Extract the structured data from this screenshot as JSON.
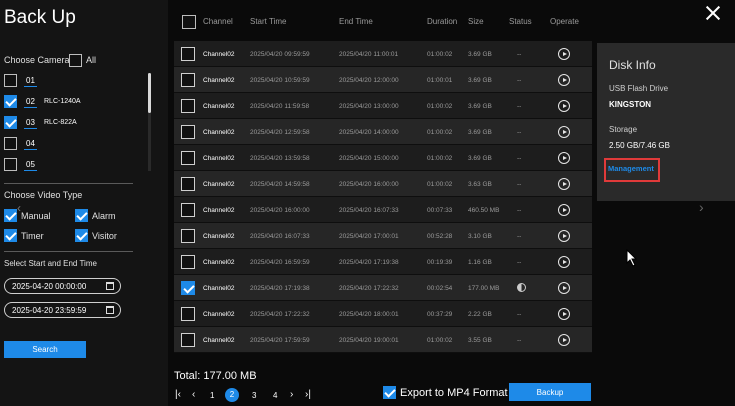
{
  "title": "Back Up",
  "camera": {
    "label": "Choose Camera",
    "all_label": "All",
    "items": [
      {
        "num": "01",
        "model": "",
        "checked": false
      },
      {
        "num": "02",
        "model": "RLC-1240A",
        "checked": true
      },
      {
        "num": "03",
        "model": "RLC-822A",
        "checked": true
      },
      {
        "num": "04",
        "model": "",
        "checked": false
      },
      {
        "num": "05",
        "model": "",
        "checked": false
      }
    ]
  },
  "video_type": {
    "label": "Choose Video Type",
    "items": [
      {
        "label": "Manual",
        "checked": true
      },
      {
        "label": "Alarm",
        "checked": true
      },
      {
        "label": "Timer",
        "checked": true
      },
      {
        "label": "Visitor",
        "checked": true
      }
    ]
  },
  "time_range": {
    "label": "Select Start and End Time",
    "start": "2025-04-20 00:00:00",
    "end": "2025-04-20 23:59:59"
  },
  "search_label": "Search",
  "table": {
    "headers": {
      "channel": "Channel",
      "start": "Start Time",
      "end": "End Time",
      "duration": "Duration",
      "size": "Size",
      "status": "Status",
      "operate": "Operate"
    },
    "rows": [
      {
        "channel": "Channel02",
        "start": "2025/04/20 09:59:59",
        "end": "2025/04/20 11:00:01",
        "duration": "01:00:02",
        "size": "3.69 GB",
        "status": "--",
        "checked": false
      },
      {
        "channel": "Channel02",
        "start": "2025/04/20 10:59:59",
        "end": "2025/04/20 12:00:00",
        "duration": "01:00:01",
        "size": "3.69 GB",
        "status": "--",
        "checked": false
      },
      {
        "channel": "Channel02",
        "start": "2025/04/20 11:59:58",
        "end": "2025/04/20 13:00:00",
        "duration": "01:00:02",
        "size": "3.69 GB",
        "status": "--",
        "checked": false
      },
      {
        "channel": "Channel02",
        "start": "2025/04/20 12:59:58",
        "end": "2025/04/20 14:00:00",
        "duration": "01:00:02",
        "size": "3.69 GB",
        "status": "--",
        "checked": false
      },
      {
        "channel": "Channel02",
        "start": "2025/04/20 13:59:58",
        "end": "2025/04/20 15:00:00",
        "duration": "01:00:02",
        "size": "3.69 GB",
        "status": "--",
        "checked": false
      },
      {
        "channel": "Channel02",
        "start": "2025/04/20 14:59:58",
        "end": "2025/04/20 16:00:00",
        "duration": "01:00:02",
        "size": "3.63 GB",
        "status": "--",
        "checked": false
      },
      {
        "channel": "Channel02",
        "start": "2025/04/20 16:00:00",
        "end": "2025/04/20 16:07:33",
        "duration": "00:07:33",
        "size": "460.50 MB",
        "status": "--",
        "checked": false
      },
      {
        "channel": "Channel02",
        "start": "2025/04/20 16:07:33",
        "end": "2025/04/20 17:00:01",
        "duration": "00:52:28",
        "size": "3.10 GB",
        "status": "--",
        "checked": false
      },
      {
        "channel": "Channel02",
        "start": "2025/04/20 16:59:59",
        "end": "2025/04/20 17:19:38",
        "duration": "00:19:39",
        "size": "1.16 GB",
        "status": "--",
        "checked": false
      },
      {
        "channel": "Channel02",
        "start": "2025/04/20 17:19:38",
        "end": "2025/04/20 17:22:32",
        "duration": "00:02:54",
        "size": "177.00 MB",
        "status": "",
        "checked": true
      },
      {
        "channel": "Channel02",
        "start": "2025/04/20 17:22:32",
        "end": "2025/04/20 18:00:01",
        "duration": "00:37:29",
        "size": "2.22 GB",
        "status": "--",
        "checked": false
      },
      {
        "channel": "Channel02",
        "start": "2025/04/20 17:59:59",
        "end": "2025/04/20 19:00:01",
        "duration": "01:00:02",
        "size": "3.55 GB",
        "status": "--",
        "checked": false
      }
    ]
  },
  "total": "Total: 177.00 MB",
  "pagination": {
    "pages": [
      "1",
      "2",
      "3",
      "4"
    ],
    "current": "2"
  },
  "export_label": "Export to MP4 Format",
  "backup_label": "Backup",
  "disk": {
    "title": "Disk Info",
    "device_label": "USB Flash Drive",
    "device_name": "KINGSTON",
    "storage_label": "Storage",
    "storage_value": "2.50 GB/7.46 GB",
    "management_label": "Management"
  },
  "colors": {
    "accent": "#1e8ae8",
    "highlight": "#e03a3a"
  }
}
